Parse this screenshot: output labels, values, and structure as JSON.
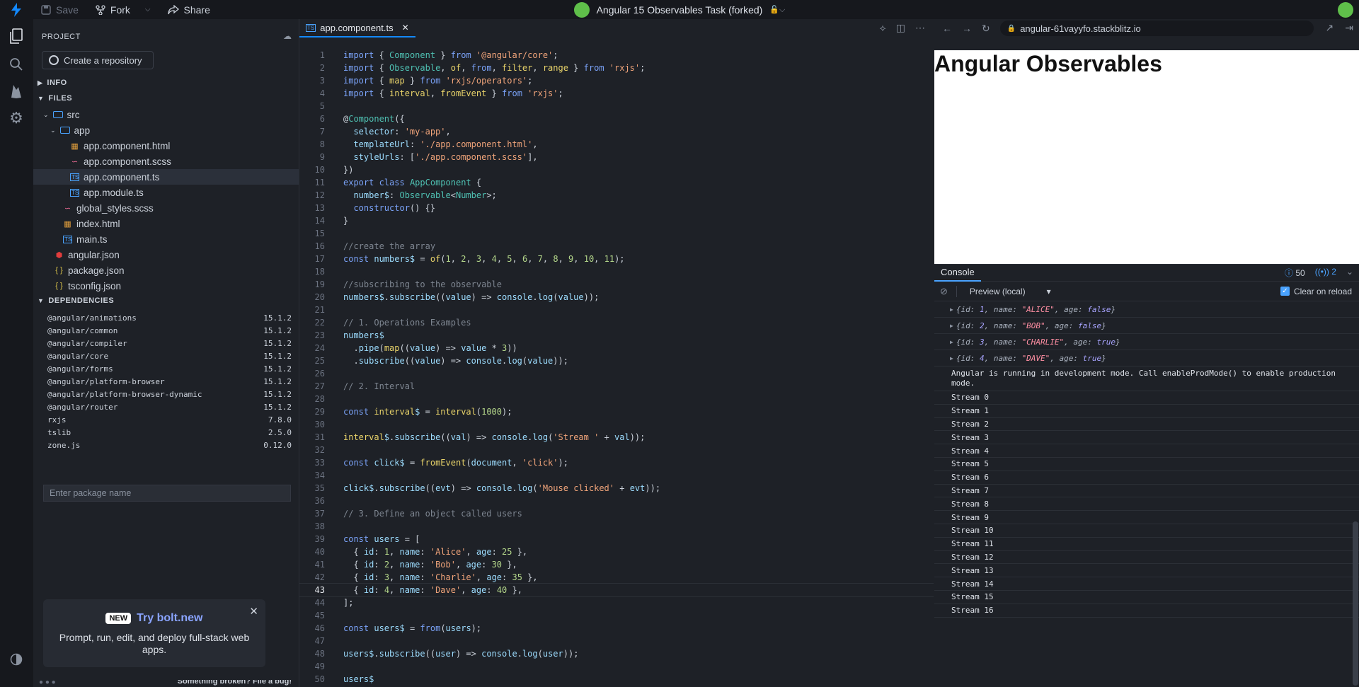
{
  "topbar": {
    "save": "Save",
    "fork": "Fork",
    "share": "Share",
    "project_title": "Angular 15 Observables Task (forked)"
  },
  "sidebar": {
    "title": "PROJECT",
    "create_repo": "Create a repository",
    "sections": {
      "info": "INFO",
      "files": "FILES",
      "dependencies": "DEPENDENCIES"
    },
    "files": [
      {
        "name": "src",
        "type": "folder"
      },
      {
        "name": "app",
        "type": "folder"
      },
      {
        "name": "app.component.html",
        "type": "html"
      },
      {
        "name": "app.component.scss",
        "type": "scss"
      },
      {
        "name": "app.component.ts",
        "type": "ts"
      },
      {
        "name": "app.module.ts",
        "type": "ts"
      },
      {
        "name": "global_styles.scss",
        "type": "scss"
      },
      {
        "name": "index.html",
        "type": "html"
      },
      {
        "name": "main.ts",
        "type": "ts"
      },
      {
        "name": "angular.json",
        "type": "angular"
      },
      {
        "name": "package.json",
        "type": "json"
      },
      {
        "name": "tsconfig.json",
        "type": "json"
      }
    ],
    "dependencies": [
      {
        "name": "@angular/animations",
        "version": "15.1.2"
      },
      {
        "name": "@angular/common",
        "version": "15.1.2"
      },
      {
        "name": "@angular/compiler",
        "version": "15.1.2"
      },
      {
        "name": "@angular/core",
        "version": "15.1.2"
      },
      {
        "name": "@angular/forms",
        "version": "15.1.2"
      },
      {
        "name": "@angular/platform-browser",
        "version": "15.1.2"
      },
      {
        "name": "@angular/platform-browser-dynamic",
        "version": "15.1.2"
      },
      {
        "name": "@angular/router",
        "version": "15.1.2"
      },
      {
        "name": "rxjs",
        "version": "7.8.0"
      },
      {
        "name": "tslib",
        "version": "2.5.0"
      },
      {
        "name": "zone.js",
        "version": "0.12.0"
      }
    ],
    "package_placeholder": "Enter package name",
    "bolt": {
      "badge": "NEW",
      "link": "Try bolt.new",
      "text": "Prompt, run, edit, and deploy full-stack web apps."
    },
    "footer": "Something broken? File a bug!"
  },
  "editor": {
    "tab": "app.component.ts",
    "current_line": 43,
    "lines": [
      "import { Component } from '@angular/core';",
      "import { Observable, of, from, filter, range } from 'rxjs';",
      "import { map } from 'rxjs/operators';",
      "import { interval, fromEvent } from 'rxjs';",
      "",
      "@Component({",
      "  selector: 'my-app',",
      "  templateUrl: './app.component.html',",
      "  styleUrls: ['./app.component.scss'],",
      "})",
      "export class AppComponent {",
      "  number$: Observable<Number>;",
      "  constructor() {}",
      "}",
      "",
      "//create the array",
      "const numbers$ = of(1, 2, 3, 4, 5, 6, 7, 8, 9, 10, 11);",
      "",
      "//subscribing to the observable",
      "numbers$.subscribe((value) => console.log(value));",
      "",
      "// 1. Operations Examples",
      "numbers$",
      "  .pipe(map((value) => value * 3))",
      "  .subscribe((value) => console.log(value));",
      "",
      "// 2. Interval",
      "",
      "const interval$ = interval(1000);",
      "",
      "interval$.subscribe((val) => console.log('Stream ' + val));",
      "",
      "const click$ = fromEvent(document, 'click');",
      "",
      "click$.subscribe((evt) => console.log('Mouse clicked' + evt));",
      "",
      "// 3. Define an object called users",
      "",
      "const users = [",
      "  { id: 1, name: 'Alice', age: 25 },",
      "  { id: 2, name: 'Bob', age: 30 },",
      "  { id: 3, name: 'Charlie', age: 35 },",
      "  { id: 4, name: 'Dave', age: 40 },",
      "];",
      "",
      "const users$ = from(users);",
      "",
      "users$.subscribe((user) => console.log(user));",
      "",
      "users$"
    ]
  },
  "preview": {
    "url": "angular-61vayyfo.stackblitz.io",
    "heading": "Angular Observables",
    "console": {
      "tab": "Console",
      "info_count": "50",
      "warn_count": "2",
      "context": "Preview (local)",
      "clear_on_reload": "Clear on reload",
      "objects": [
        {
          "id": "1",
          "name": "\"ALICE\"",
          "age": "false"
        },
        {
          "id": "2",
          "name": "\"BOB\"",
          "age": "false"
        },
        {
          "id": "3",
          "name": "\"CHARLIE\"",
          "age": "true"
        },
        {
          "id": "4",
          "name": "\"DAVE\"",
          "age": "true"
        }
      ],
      "dev_mode_msg": "Angular is running in development mode. Call enableProdMode() to enable production mode.",
      "streams": [
        "Stream 0",
        "Stream 1",
        "Stream 2",
        "Stream 3",
        "Stream 4",
        "Stream 5",
        "Stream 6",
        "Stream 7",
        "Stream 8",
        "Stream 9",
        "Stream 10",
        "Stream 11",
        "Stream 12",
        "Stream 13",
        "Stream 14",
        "Stream 15",
        "Stream 16"
      ]
    }
  }
}
